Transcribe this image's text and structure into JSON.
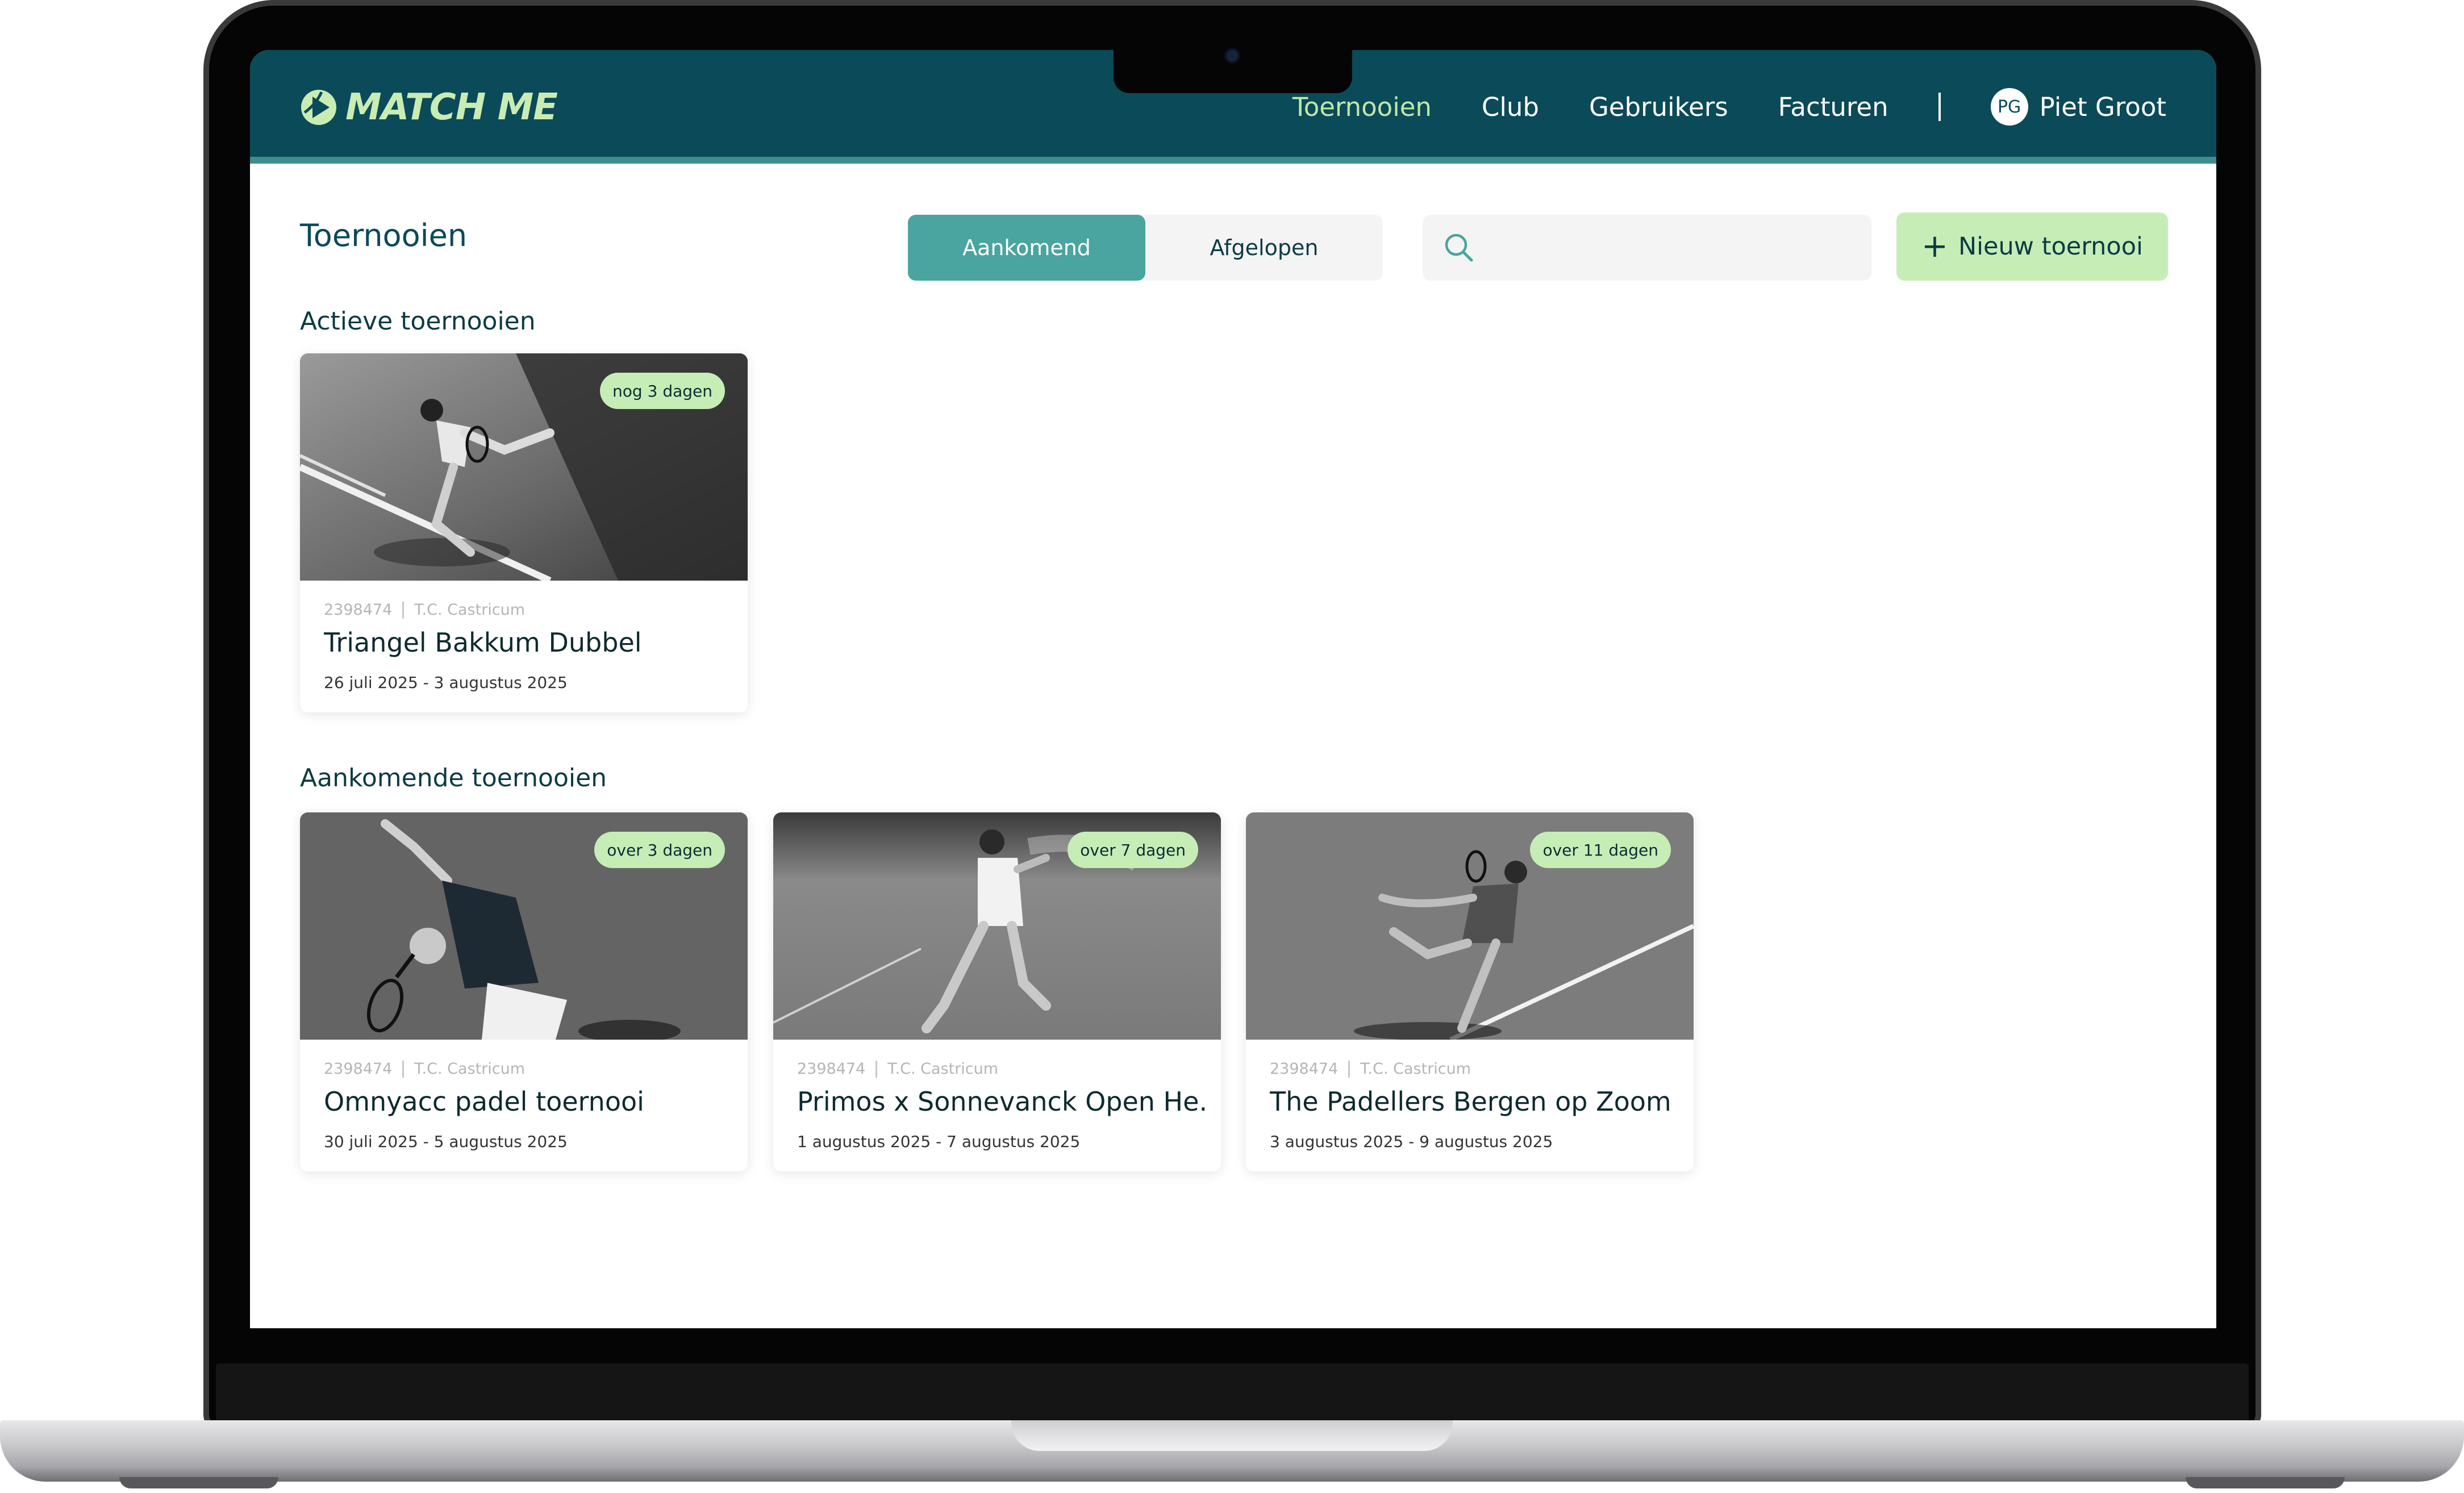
{
  "app": {
    "logo_text": "MATCH ME"
  },
  "nav": {
    "items": [
      "Toernooien",
      "Club",
      "Gebruikers",
      "Facturen"
    ],
    "user_initials": "PG",
    "user_name": "Piet Groot"
  },
  "toolbar": {
    "page_title": "Toernooien",
    "tabs": [
      "Aankomend",
      "Afgelopen"
    ],
    "search_placeholder": "",
    "new_button_label": "Nieuw toernooi"
  },
  "sections": {
    "active_title": "Actieve toernooien",
    "upcoming_title": "Aankomende toernooien"
  },
  "active_tournaments": [
    {
      "badge": "nog 3 dagen",
      "id": "2398474",
      "club": "T.C. Castricum",
      "title": "Triangel Bakkum Dubbel",
      "dates": "26 juli 2025 - 3 augustus 2025"
    }
  ],
  "upcoming_tournaments": [
    {
      "badge": "over 3 dagen",
      "id": "2398474",
      "club": "T.C. Castricum",
      "title": "Omnyacc padel toernooi",
      "dates": "30 juli 2025 - 5 augustus 2025"
    },
    {
      "badge": "over 7 dagen",
      "id": "2398474",
      "club": "T.C. Castricum",
      "title": "Primos x Sonnevanck Open He...",
      "dates": "1 augustus 2025 - 7 augustus 2025"
    },
    {
      "badge": "over 11 dagen",
      "id": "2398474",
      "club": "T.C. Castricum",
      "title": "The Padellers Bergen op Zoom",
      "dates": "3 augustus 2025 - 9 augustus 2025"
    }
  ],
  "colors": {
    "brand_dark": "#0b4a58",
    "brand_accent": "#4aa49f",
    "logo_green": "#c9ecb3",
    "badge_green": "#c6edb6"
  }
}
